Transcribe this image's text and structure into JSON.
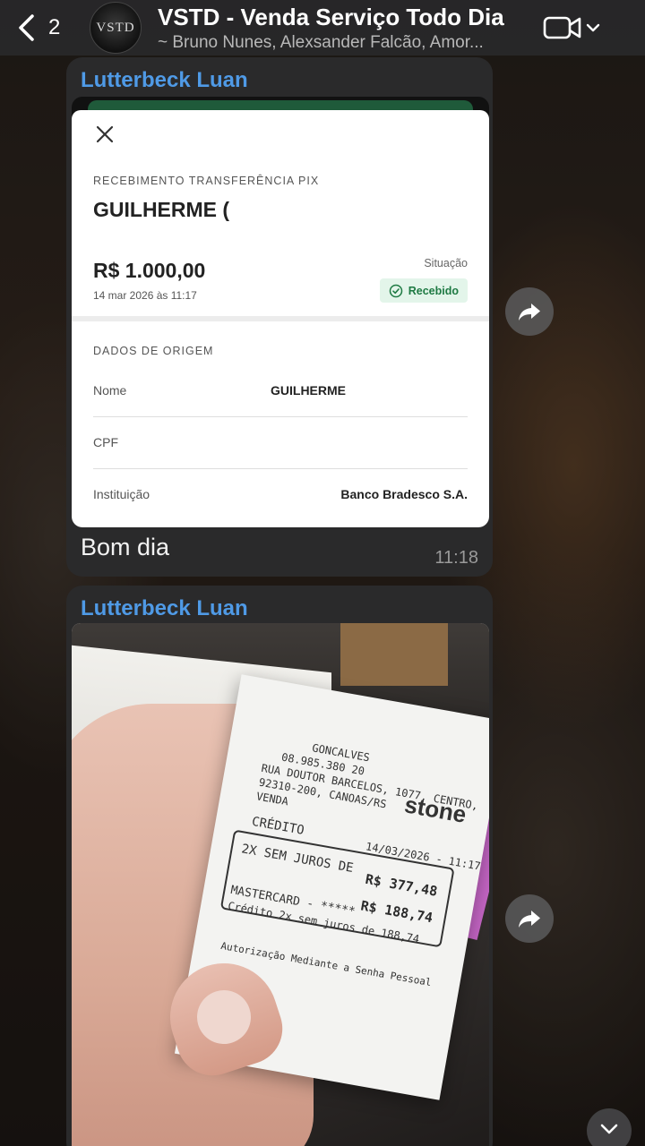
{
  "header": {
    "back_count": "2",
    "avatar_text": "VSTD",
    "title": "VSTD - Venda Serviço Todo Dia",
    "subtitle": "~ Bruno Nunes, Alexsander Falcão, Amor..."
  },
  "messages": [
    {
      "sender": "Lutterbeck Luan",
      "receipt": {
        "kicker": "RECEBIMENTO TRANSFERÊNCIA PIX",
        "payer": "GUILHERME (",
        "amount": "R$ 1.000,00",
        "date": "14 mar 2026 às 11:17",
        "status_label": "Situação",
        "status_value": "Recebido",
        "section_title": "DADOS DE ORIGEM",
        "rows": [
          {
            "label": "Nome",
            "value": "GUILHERME"
          },
          {
            "label": "CPF",
            "value": ""
          },
          {
            "label": "Instituição",
            "value": "Banco Bradesco S.A."
          }
        ]
      },
      "text": "Bom dia",
      "time": "11:18"
    },
    {
      "sender": "Lutterbeck Luan",
      "photo_receipt": {
        "brand": "stone",
        "lines": [
          "GONCALVES",
          "08.985.380 20",
          "RUA DOUTOR BARCELOS, 1077, CENTRO,",
          "92310-200, CANOAS/RS",
          "VENDA"
        ],
        "credit_label": "CRÉDITO",
        "credit_date": "14/03/2026 - 11:17",
        "installments": "2X SEM JUROS DE",
        "total": "R$ 377,48",
        "installment_value": "R$ 188,74",
        "card": "MASTERCARD - *****",
        "detail": "Crédito 2x sem juros de 188,74",
        "footer": "Autorização Mediante a Senha Pessoal"
      }
    }
  ],
  "colors": {
    "sender": "#4f9ae6",
    "bubble": "#2a2a2b",
    "header": "#28282a",
    "badge_bg": "#e3f5ea",
    "badge_fg": "#1e7a43"
  },
  "icons": [
    "back-chevron-icon",
    "video-call-icon",
    "chevron-down-icon",
    "close-icon",
    "check-circle-icon",
    "forward-icon",
    "scroll-down-icon"
  ]
}
